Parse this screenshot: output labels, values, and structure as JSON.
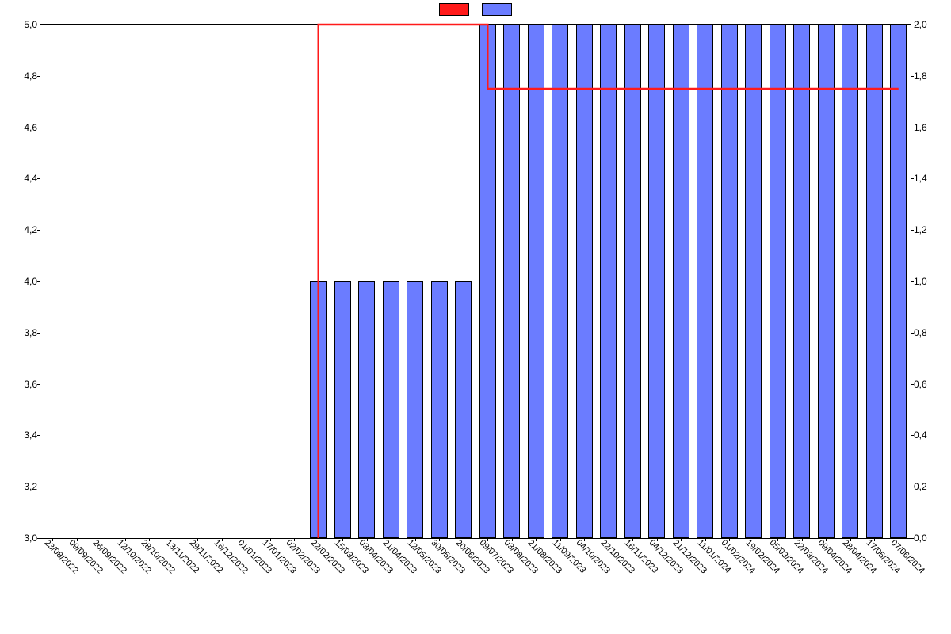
{
  "legend": {
    "series1_name": "",
    "series2_name": ""
  },
  "chart_data": {
    "type": "bar+line",
    "categories": [
      "23/08/2022",
      "09/09/2022",
      "26/09/2022",
      "12/10/2022",
      "28/10/2022",
      "13/11/2022",
      "29/11/2022",
      "16/12/2022",
      "01/01/2023",
      "17/01/2023",
      "02/02/2023",
      "22/02/2023",
      "15/03/2023",
      "03/04/2023",
      "21/04/2023",
      "12/05/2023",
      "30/05/2023",
      "20/06/2023",
      "09/07/2023",
      "03/08/2023",
      "21/08/2023",
      "11/09/2023",
      "04/10/2023",
      "22/10/2023",
      "16/11/2023",
      "04/12/2023",
      "21/12/2023",
      "11/01/2024",
      "01/02/2024",
      "19/02/2024",
      "05/03/2024",
      "22/03/2024",
      "09/04/2024",
      "28/04/2024",
      "17/05/2024",
      "07/06/2024"
    ],
    "series": [
      {
        "name": "",
        "type": "line",
        "color": "#ff1a1a",
        "axis": "left",
        "values": [
          null,
          null,
          null,
          null,
          null,
          null,
          null,
          null,
          null,
          null,
          null,
          5.0,
          5.0,
          5.0,
          5.0,
          5.0,
          5.0,
          5.0,
          4.75,
          4.75,
          4.75,
          4.75,
          4.75,
          4.75,
          4.75,
          4.75,
          4.75,
          4.75,
          4.75,
          4.75,
          4.75,
          4.75,
          4.75,
          4.75,
          4.75,
          4.75
        ]
      },
      {
        "name": "",
        "type": "bar",
        "color": "#6b7cff",
        "axis": "right",
        "values": [
          0,
          0,
          0,
          0,
          0,
          0,
          0,
          0,
          0,
          0,
          0,
          1,
          1,
          1,
          1,
          1,
          1,
          1,
          2,
          2,
          2,
          2,
          2,
          2,
          2,
          2,
          2,
          2,
          2,
          2,
          2,
          2,
          2,
          2,
          2,
          2
        ]
      }
    ],
    "y_left": {
      "min": 3.0,
      "max": 5.0,
      "ticks": [
        3.0,
        3.2,
        3.4,
        3.6,
        3.8,
        4.0,
        4.2,
        4.4,
        4.6,
        4.8,
        5.0
      ],
      "tick_labels": [
        "3,0",
        "3,2",
        "3,4",
        "3,6",
        "3,8",
        "4,0",
        "4,2",
        "4,4",
        "4,6",
        "4,8",
        "5,0"
      ]
    },
    "y_right": {
      "min": 0.0,
      "max": 2.0,
      "ticks": [
        0.0,
        0.2,
        0.4,
        0.6,
        0.8,
        1.0,
        1.2,
        1.4,
        1.6,
        1.8,
        2.0
      ],
      "tick_labels": [
        "0,0",
        "0,2",
        "0,4",
        "0,6",
        "0,8",
        "1,0",
        "1,2",
        "1,4",
        "1,6",
        "1,8",
        "2,0"
      ]
    }
  }
}
